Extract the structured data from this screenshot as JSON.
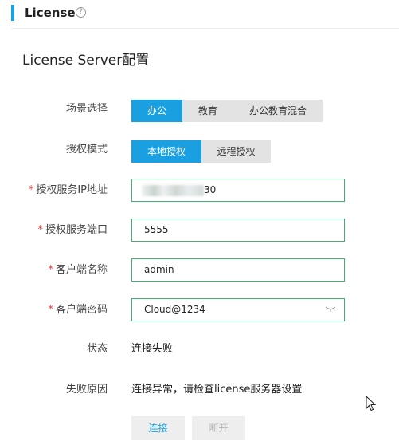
{
  "header": {
    "title": "License",
    "help_icon": "question-circle-icon"
  },
  "section": {
    "title": "License Server配置"
  },
  "form": {
    "scene": {
      "label": "场景选择",
      "options": [
        "办公",
        "教育",
        "办公教育混合"
      ],
      "selected": "办公"
    },
    "auth_mode": {
      "label": "授权模式",
      "options": [
        "本地授权",
        "远程授权"
      ],
      "selected": "本地授权"
    },
    "server_ip": {
      "label": "授权服务IP地址",
      "required_mark": "*",
      "value_visible_suffix": "30"
    },
    "server_port": {
      "label": "授权服务端口",
      "required_mark": "*",
      "value": "5555"
    },
    "client_name": {
      "label": "客户端名称",
      "required_mark": "*",
      "value": "admin"
    },
    "client_password": {
      "label": "客户端密码",
      "required_mark": "*",
      "value": "Cloud@1234",
      "icon": "eye-closed-icon"
    },
    "status": {
      "label": "状态",
      "value": "连接失败"
    },
    "fail_reason": {
      "label": "失败原因",
      "value": "连接异常，请检查license服务器设置"
    }
  },
  "actions": {
    "connect_label": "连接",
    "disconnect_label": "断开"
  },
  "colors": {
    "accent": "#1a9fe0",
    "input_border": "#3cb371",
    "required": "#e4393c"
  }
}
